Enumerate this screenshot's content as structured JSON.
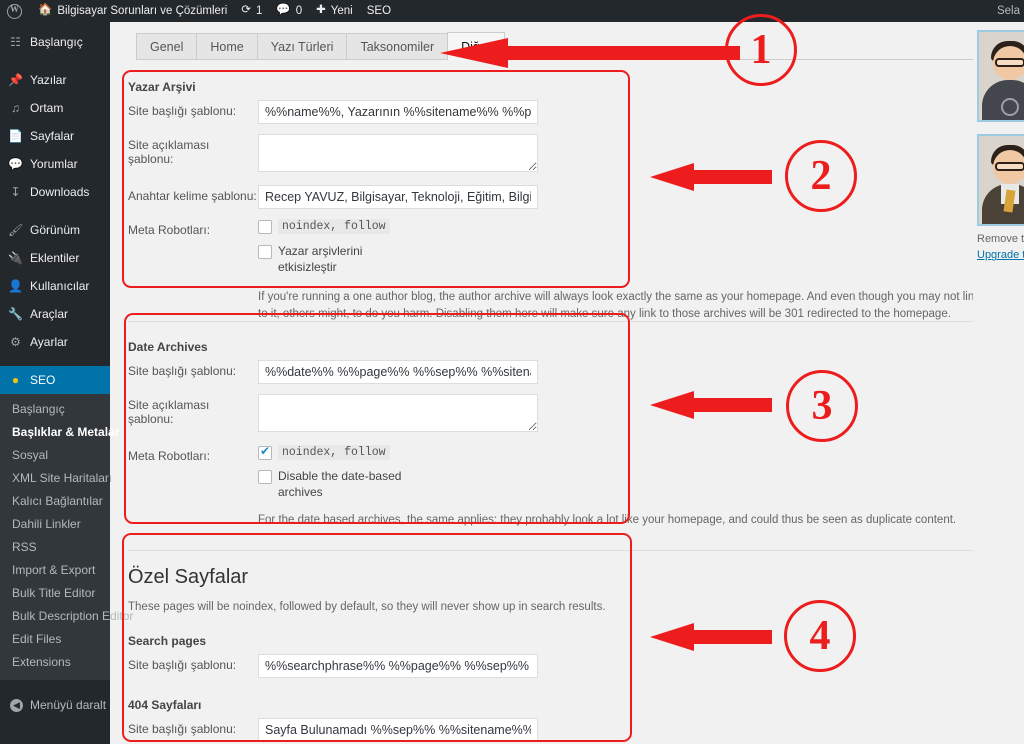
{
  "adminbar": {
    "logo_icon": "wordpress-logo-icon",
    "site_icon": "home-icon",
    "site_name": "Bilgisayar Sorunları ve Çözümleri",
    "updates_icon": "updates-icon",
    "updates_count": "1",
    "comments_icon": "comment-icon",
    "comments_count": "0",
    "new_icon": "plus-icon",
    "new_label": "Yeni",
    "seo_label": "SEO",
    "account_label": "Sela"
  },
  "sidebar": {
    "items": [
      {
        "label": "Başlangıç",
        "icon": "dashboard-icon"
      },
      {
        "label": "Yazılar",
        "icon": "pin-icon"
      },
      {
        "label": "Ortam",
        "icon": "media-icon"
      },
      {
        "label": "Sayfalar",
        "icon": "pages-icon"
      },
      {
        "label": "Yorumlar",
        "icon": "comment-icon"
      },
      {
        "label": "Downloads",
        "icon": "download-icon"
      },
      {
        "label": "Görünüm",
        "icon": "appearance-icon"
      },
      {
        "label": "Eklentiler",
        "icon": "plugins-icon"
      },
      {
        "label": "Kullanıcılar",
        "icon": "users-icon"
      },
      {
        "label": "Araçlar",
        "icon": "tools-icon"
      },
      {
        "label": "Ayarlar",
        "icon": "settings-icon"
      },
      {
        "label": "SEO",
        "icon": "yoast-seo-icon"
      }
    ],
    "submenu": [
      "Başlangıç",
      "Başlıklar & Metalar",
      "Sosyal",
      "XML Site Haritaları",
      "Kalıcı Bağlantılar",
      "Dahili Linkler",
      "RSS",
      "Import & Export",
      "Bulk Title Editor",
      "Bulk Description Editor",
      "Edit Files",
      "Extensions"
    ],
    "submenu_active": "Başlıklar & Metalar",
    "collapse_label": "Menüyü daralt",
    "collapse_icon": "collapse-arrow-icon"
  },
  "tabs": [
    {
      "label": "Genel",
      "active": false
    },
    {
      "label": "Home",
      "active": false
    },
    {
      "label": "Yazı Türleri",
      "active": false
    },
    {
      "label": "Taksonomiler",
      "active": false
    },
    {
      "label": "Diğer",
      "active": true
    }
  ],
  "author_archive": {
    "heading": "Yazar Arşivi",
    "title_label": "Site başlığı şablonu:",
    "title_value": "%%name%%, Yazarının %%sitename%% %%page%%",
    "desc_label": "Site açıklaması şablonu:",
    "desc_value": "",
    "keyword_label": "Anahtar kelime şablonu:",
    "keyword_value": "Recep YAVUZ, Bilgisayar, Teknoloji, Eğitim, Bilgisayar Sorunları",
    "robots_label": "Meta Robotları:",
    "noindex_label": "noindex, follow",
    "noindex_checked": false,
    "disable_label": "Yazar arşivlerini etkisizleştir",
    "disable_checked": false,
    "help": "If you're running a one author blog, the author archive will always look exactly the same as your homepage. And even though you may not link to it, others might, to do you harm. Disabling them here will make sure any link to those archives will be 301 redirected to the homepage."
  },
  "date_archive": {
    "heading": "Date Archives",
    "title_label": "Site başlığı şablonu:",
    "title_value": "%%date%% %%page%% %%sep%% %%sitename%%",
    "desc_label": "Site açıklaması şablonu:",
    "desc_value": "",
    "robots_label": "Meta Robotları:",
    "noindex_label": "noindex, follow",
    "noindex_checked": true,
    "disable_label": "Disable the date-based archives",
    "disable_checked": false,
    "help": "For the date based archives, the same applies: they probably look a lot like your homepage, and could thus be seen as duplicate content."
  },
  "special_pages": {
    "heading": "Özel Sayfalar",
    "intro": "These pages will be noindex, followed by default, so they will never show up in search results.",
    "search_heading": "Search pages",
    "search_title_label": "Site başlığı şablonu:",
    "search_title_value": "%%searchphrase%% %%page%% %%sep%% %%sitename%%",
    "notfound_heading": "404 Sayfaları",
    "notfound_title_label": "Site başlığı şablonu:",
    "notfound_title_value": "Sayfa Bulunamadı %%sep%% %%sitename%%"
  },
  "promo": {
    "remove_text": "Remove t",
    "upgrade_link": "Upgrade t"
  },
  "annotations": {
    "accent_color": "#ee1d1d",
    "markers": [
      {
        "number": "1"
      },
      {
        "number": "2"
      },
      {
        "number": "3"
      },
      {
        "number": "4"
      }
    ]
  }
}
